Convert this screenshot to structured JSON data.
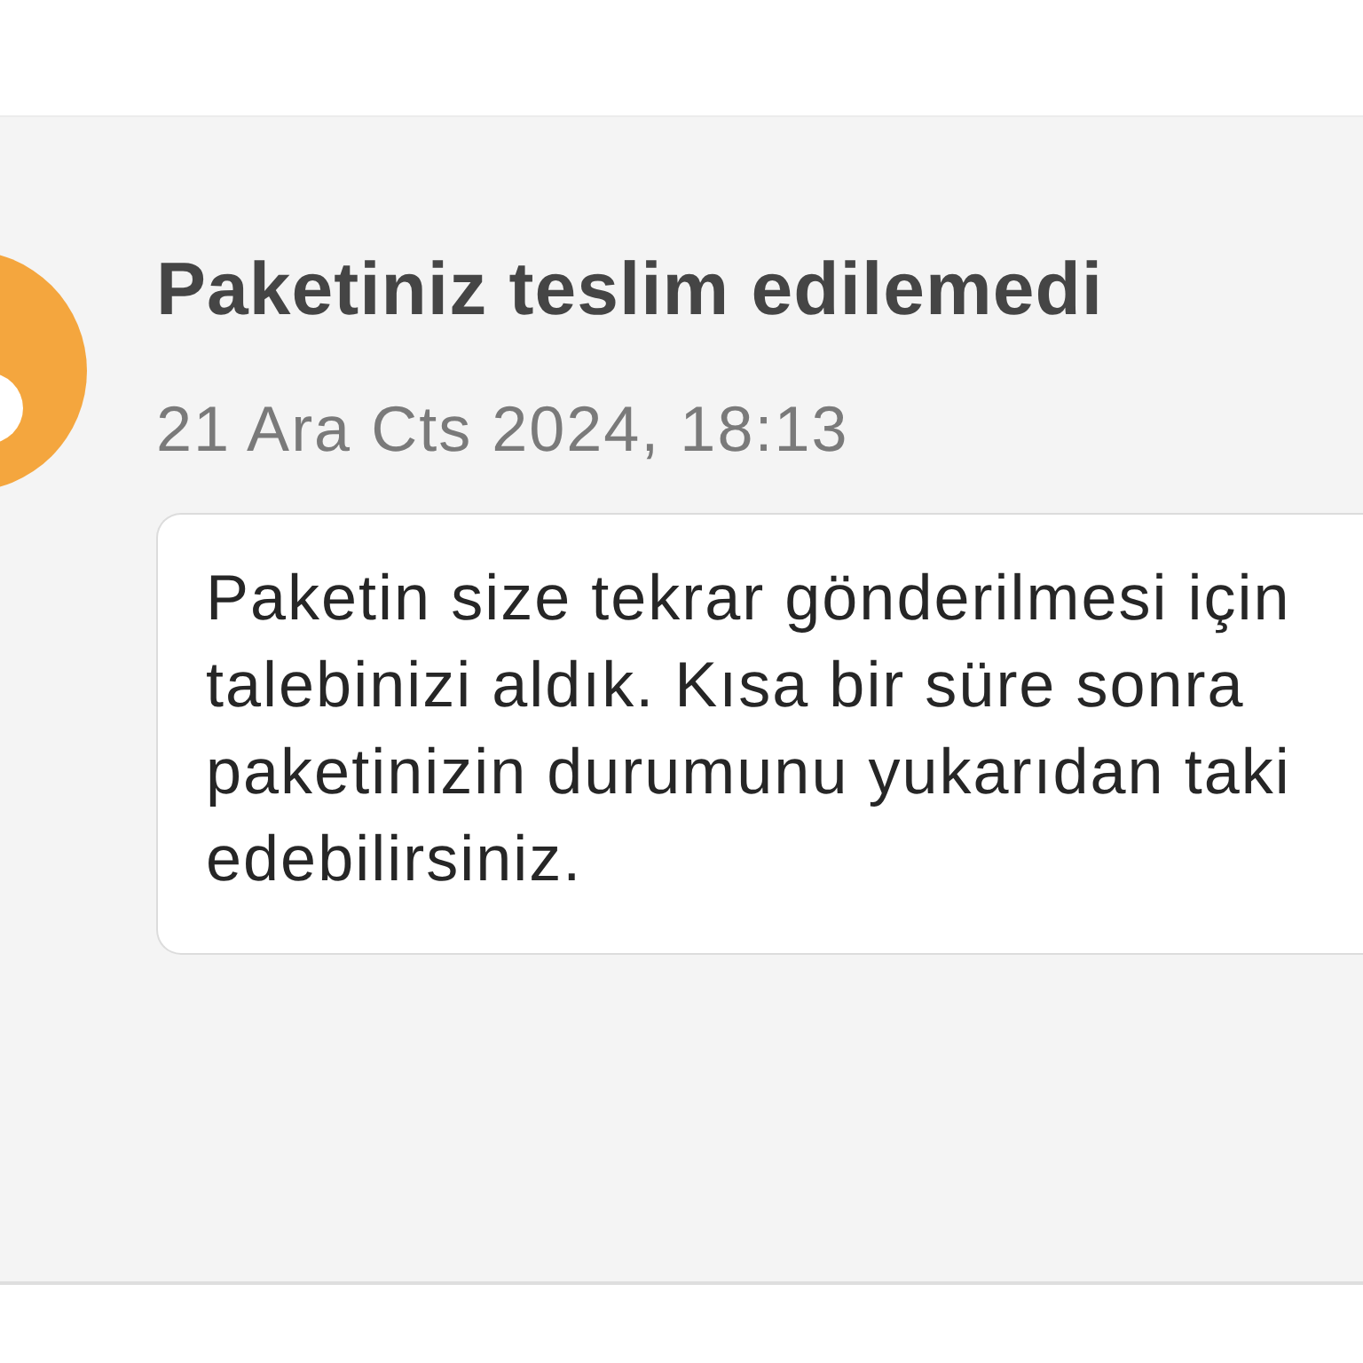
{
  "notification": {
    "title": "Paketiniz teslim edilemedi",
    "date": "21 Ara Cts 2024, 18:13",
    "message": "Paketin size tekrar gönderilmesi için\ntalebinizi aldık. Kısa bir süre sonra\npaketinizin durumunu yukarıdan taki\nedebilirsiniz."
  }
}
